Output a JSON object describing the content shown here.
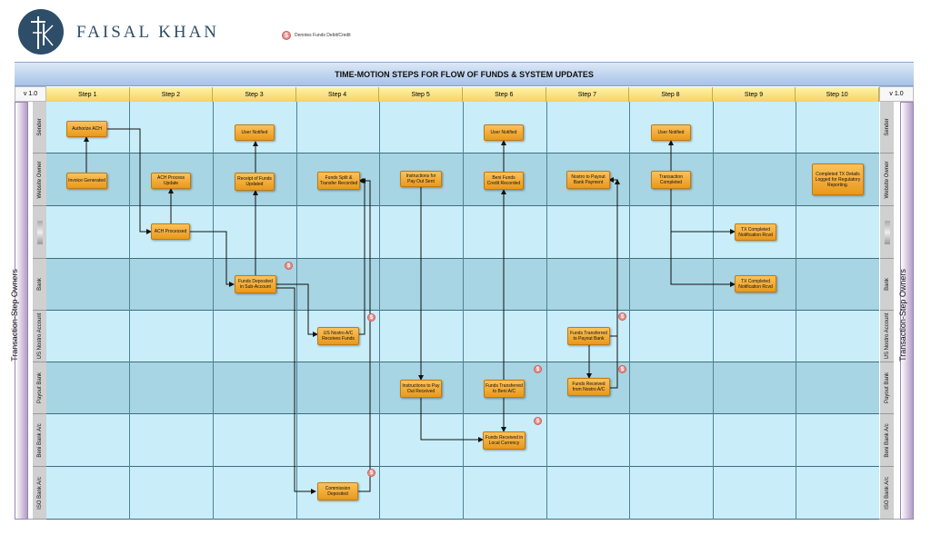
{
  "brand": {
    "name": "FAISAL KHAN"
  },
  "legend": {
    "symbol": "$",
    "text": "Denotes Funds Debit/Credit"
  },
  "title": "TIME-MOTION STEPS FOR FLOW OF FUNDS & SYSTEM UPDATES",
  "version": "v 1.0",
  "side_label": "Transaction-Step Owners",
  "steps": [
    "Step 1",
    "Step 2",
    "Step 3",
    "Step 4",
    "Step 5",
    "Step 6",
    "Step 7",
    "Step 8",
    "Step 9",
    "Step 10"
  ],
  "lanes": [
    "Sender",
    "Website Owner",
    "",
    "Bank",
    "US Nostro Account",
    "Payout Bank",
    "Beni Bank A/c",
    "ISO Bank A/c"
  ],
  "boxes": [
    {
      "id": "b1",
      "text": "Authorize ACH"
    },
    {
      "id": "b2",
      "text": "Invoice Generated"
    },
    {
      "id": "b3",
      "text": "ACH Process Update"
    },
    {
      "id": "b4",
      "text": "ACH Processed"
    },
    {
      "id": "b5",
      "text": "User Notified"
    },
    {
      "id": "b6",
      "text": "Receipt of Funds Updated"
    },
    {
      "id": "b7",
      "text": "Funds Deposited in Sub-Account"
    },
    {
      "id": "b8",
      "text": "Funds Split & Transfer Recorded"
    },
    {
      "id": "b9",
      "text": "US Nostro A/C Receives Funds"
    },
    {
      "id": "b10",
      "text": "Commission Deposited"
    },
    {
      "id": "b11",
      "text": "Instructions for Pay Out Sent"
    },
    {
      "id": "b12",
      "text": "Instructions to Pay Out Received"
    },
    {
      "id": "b13",
      "text": "User Notified"
    },
    {
      "id": "b14",
      "text": "Beni Funds Credit Recorded"
    },
    {
      "id": "b15",
      "text": "Funds Transferred to Beni A/C"
    },
    {
      "id": "b16",
      "text": "Funds Received in Local Currency"
    },
    {
      "id": "b17",
      "text": "Nostro to Payout Bank Payment"
    },
    {
      "id": "b18",
      "text": "Funds Transferred to Payout Bank"
    },
    {
      "id": "b19",
      "text": "Funds Received from Nostro A/C"
    },
    {
      "id": "b20",
      "text": "User Notified"
    },
    {
      "id": "b21",
      "text": "Transaction Completed"
    },
    {
      "id": "b22",
      "text": "TX Completed Notification Rcvd"
    },
    {
      "id": "b23",
      "text": "TX Completed Notification Rcvd"
    },
    {
      "id": "b24",
      "text": "Completed TX Details Logged for Regulatory Reporting."
    }
  ]
}
